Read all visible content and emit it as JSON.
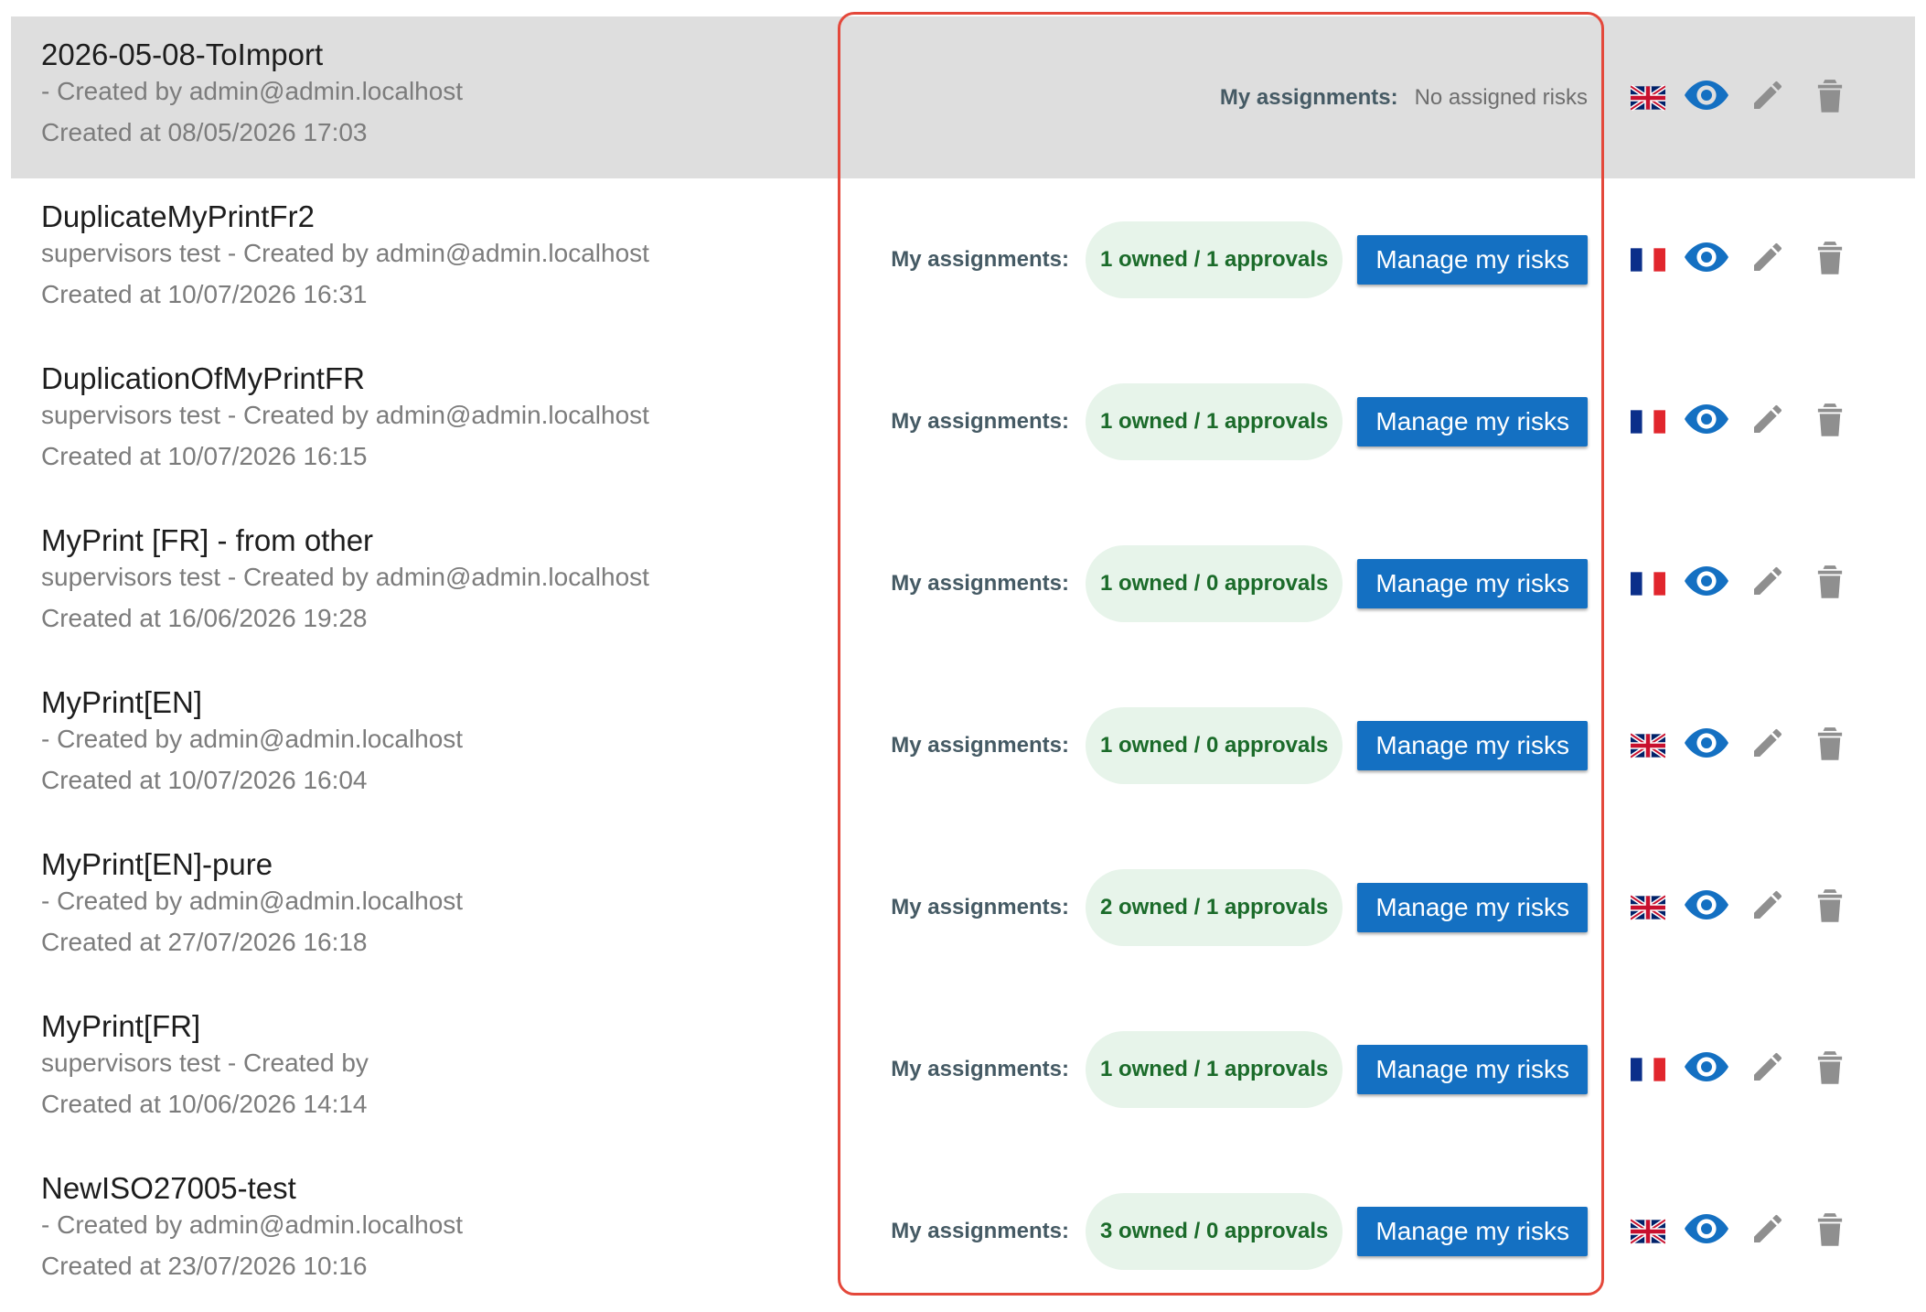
{
  "assignments_label": "My assignments:",
  "no_risks_text": "No assigned risks",
  "manage_label": "Manage my risks",
  "colors": {
    "accent": "#1470c2",
    "pill_bg": "#e7f4ea",
    "pill_text": "#1b6b2a",
    "selected_row": "#dedede",
    "highlight_border": "#e4483b"
  },
  "icons": {
    "view": "eye-icon",
    "edit": "pencil-icon",
    "delete": "trash-icon",
    "flag_en": "uk-flag-icon",
    "flag_fr": "fr-flag-icon"
  },
  "rows": [
    {
      "title": "2026-05-08-ToImport",
      "subtitle": "- Created by admin@admin.localhost",
      "created": "Created at 08/05/2026 17:03",
      "assignment": "",
      "lang": "en",
      "selected": true
    },
    {
      "title": "DuplicateMyPrintFr2",
      "subtitle": "supervisors test - Created by admin@admin.localhost",
      "created": "Created at 10/07/2026 16:31",
      "assignment": "1 owned / 1 approvals",
      "lang": "fr"
    },
    {
      "title": "DuplicationOfMyPrintFR",
      "subtitle": "supervisors test - Created by admin@admin.localhost",
      "created": "Created at 10/07/2026 16:15",
      "assignment": "1 owned / 1 approvals",
      "lang": "fr"
    },
    {
      "title": "MyPrint [FR] - from other",
      "subtitle": "supervisors test - Created by admin@admin.localhost",
      "created": "Created at 16/06/2026 19:28",
      "assignment": "1 owned / 0 approvals",
      "lang": "fr"
    },
    {
      "title": "MyPrint[EN]",
      "subtitle": "- Created by admin@admin.localhost",
      "created": "Created at 10/07/2026 16:04",
      "assignment": "1 owned / 0 approvals",
      "lang": "en"
    },
    {
      "title": "MyPrint[EN]-pure",
      "subtitle": "- Created by admin@admin.localhost",
      "created": "Created at 27/07/2026 16:18",
      "assignment": "2 owned / 1 approvals",
      "lang": "en"
    },
    {
      "title": "MyPrint[FR]",
      "subtitle": "supervisors test - Created by",
      "created": "Created at 10/06/2026 14:14",
      "assignment": "1 owned / 1 approvals",
      "lang": "fr"
    },
    {
      "title": "NewISO27005-test",
      "subtitle": "- Created by admin@admin.localhost",
      "created": "Created at 23/07/2026 10:16",
      "assignment": "3 owned / 0 approvals",
      "lang": "en"
    }
  ]
}
